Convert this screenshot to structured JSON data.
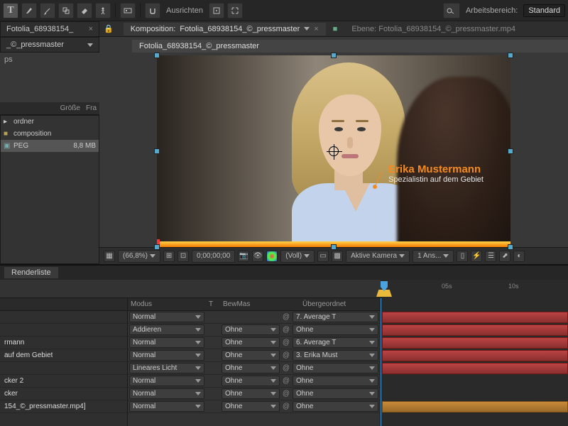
{
  "toolbar": {
    "align_label": "Ausrichten",
    "workspace_label": "Arbeitsbereich:",
    "workspace_value": "Standard"
  },
  "project": {
    "tab1": "Fotolia_68938154_",
    "tab2": "_©_pressmaster",
    "sub": "ps",
    "col_size": "Größe",
    "col_fr": "Fra",
    "rows": [
      {
        "name": "ordner",
        "size": "",
        "icon": "folder"
      },
      {
        "name": "composition",
        "size": "",
        "icon": "comp"
      },
      {
        "name": "PEG",
        "size": "8,8 MB",
        "icon": "video"
      }
    ]
  },
  "comp": {
    "tab_prefix": "Komposition:",
    "tab_name": "Fotolia_68938154_©_pressmaster",
    "layer_tab": "Ebene: Fotolia_68938154_©_pressmaster.mp4",
    "flow_tab": "Fotolia_68938154_©_pressmaster"
  },
  "lower_third": {
    "name": "Erika Mustermann",
    "subtitle": "Spezialistin auf dem Gebiet"
  },
  "viewer_footer": {
    "zoom": "(66,8%)",
    "timecode": "0;00;00;00",
    "res": "(Voll)",
    "camera": "Aktive Kamera",
    "views": "1 Ans..."
  },
  "timeline": {
    "renderlist_tab": "Renderliste",
    "ruler": [
      "05s",
      "10s"
    ],
    "col_modus": "Modus",
    "col_t": "T",
    "col_bewmas": "BewMas",
    "col_parent": "Übergeordnet",
    "layers": [
      {
        "name": "",
        "mode": "Normal",
        "mask": "",
        "parent": "7. Average T"
      },
      {
        "name": "",
        "mode": "Addieren",
        "mask": "Ohne",
        "parent": "Ohne"
      },
      {
        "name": "rmann",
        "mode": "Normal",
        "mask": "Ohne",
        "parent": "6. Average T"
      },
      {
        "name": "auf dem Gebiet",
        "mode": "Normal",
        "mask": "Ohne",
        "parent": "3. Erika Must"
      },
      {
        "name": "",
        "mode": "Lineares Licht",
        "mask": "Ohne",
        "parent": "Ohne"
      },
      {
        "name": "cker 2",
        "mode": "Normal",
        "mask": "Ohne",
        "parent": "Ohne"
      },
      {
        "name": "cker",
        "mode": "Normal",
        "mask": "Ohne",
        "parent": "Ohne"
      },
      {
        "name": "154_©_pressmaster.mp4]",
        "mode": "Normal",
        "mask": "Ohne",
        "parent": "Ohne"
      }
    ]
  }
}
